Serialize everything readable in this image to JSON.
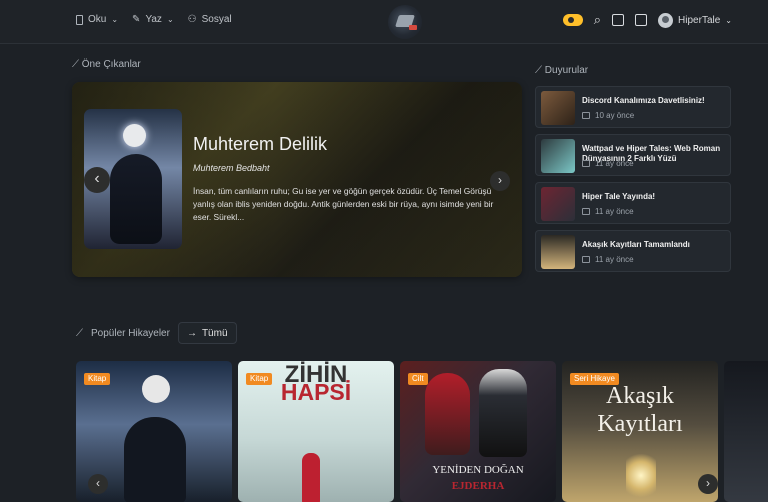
{
  "nav": {
    "items": [
      {
        "label": "Oku",
        "icon": "book-icon"
      },
      {
        "label": "Yaz",
        "icon": "pen-icon"
      },
      {
        "label": "Sosyal",
        "icon": "users-icon"
      }
    ]
  },
  "header": {
    "user": "HiperTale",
    "colors": {
      "toggle": "#ffbf2a",
      "background": "#1d2126"
    }
  },
  "featured": {
    "title": "Öne Çıkanlar",
    "book_title": "Muhterem Delilik",
    "author": "Muhterem Bedbaht",
    "description": "İnsan, tüm canlıların ruhu; Gu ise yer ve göğün gerçek özüdür. Üç Temel Görüşü yanlış olan iblis yeniden doğdu. Antik günlerden eski bir rüya, aynı isimde yeni bir eser. Sürekl..."
  },
  "announcements": {
    "title": "Duyurular",
    "items": [
      {
        "title": "Discord Kanalımıza Davetlisiniz!",
        "date": "10 ay önce"
      },
      {
        "title": "Wattpad ve Hiper Tales: Web Roman Dünyasının 2 Farklı Yüzü",
        "date": "11 ay önce"
      },
      {
        "title": "Hiper Tale Yayında!",
        "date": "11 ay önce"
      },
      {
        "title": "Akaşık Kayıtları Tamamlandı",
        "date": "11 ay önce"
      }
    ]
  },
  "popular": {
    "title": "Popüler Hikayeler",
    "all_label": "Tümü",
    "cards": [
      {
        "badge": "Kitap"
      },
      {
        "badge": "Kitap",
        "cover_top": "ZİHİN",
        "cover_main": "HAPSİ"
      },
      {
        "badge": "Cilt",
        "cover_top": "YENİDEN DOĞAN",
        "cover_main": "EJDERHA"
      },
      {
        "badge": "Seri Hikaye",
        "cover_top": "Akaşık",
        "cover_main": "Kayıtları"
      }
    ]
  }
}
